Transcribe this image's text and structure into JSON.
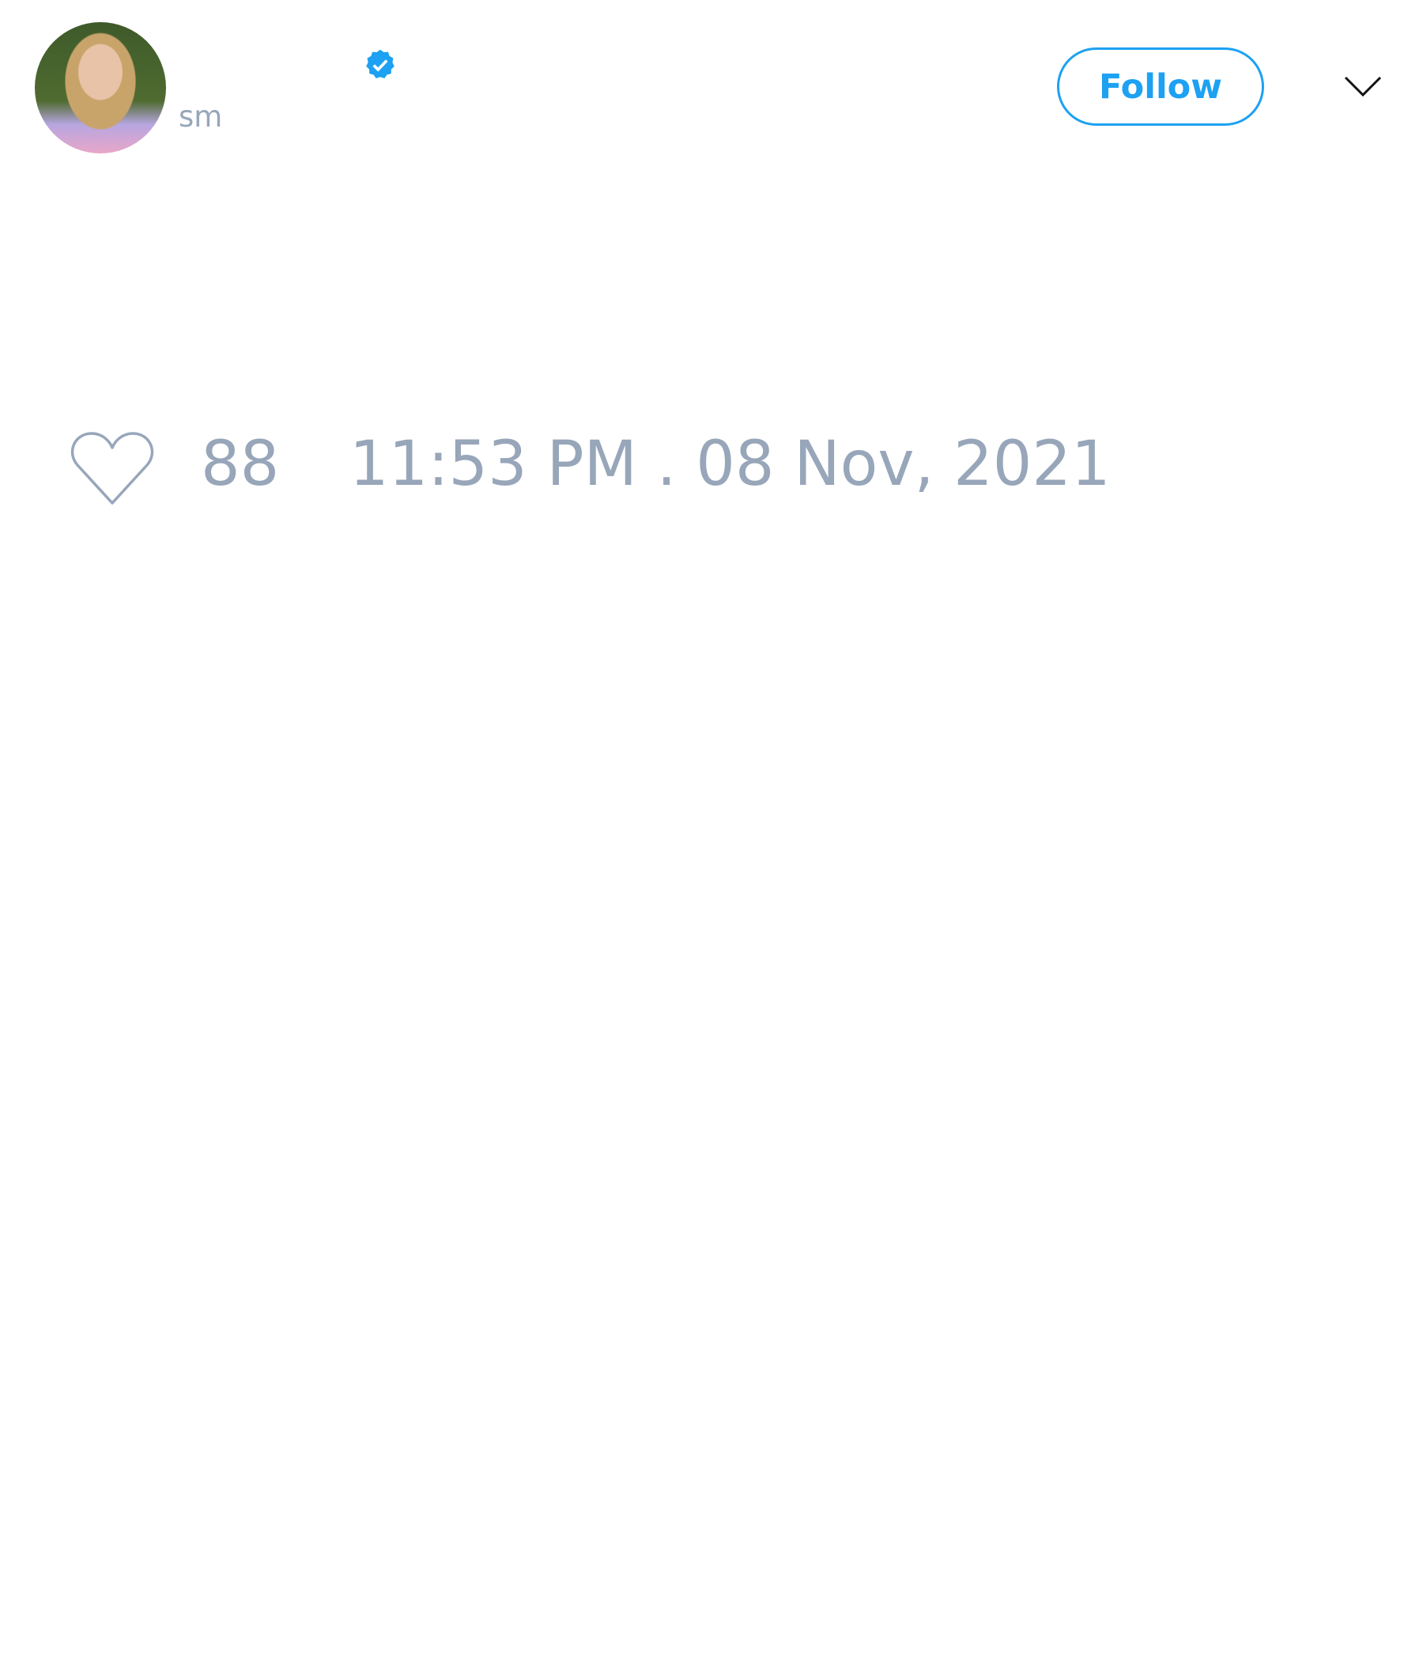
{
  "tweet": {
    "handle": "sm",
    "verified": true,
    "follow_label": "Follow",
    "likes": "88",
    "timestamp": "11:53 PM . 08 Nov, 2021"
  },
  "colors": {
    "accent": "#1da1f2",
    "muted": "#98a6ba"
  }
}
